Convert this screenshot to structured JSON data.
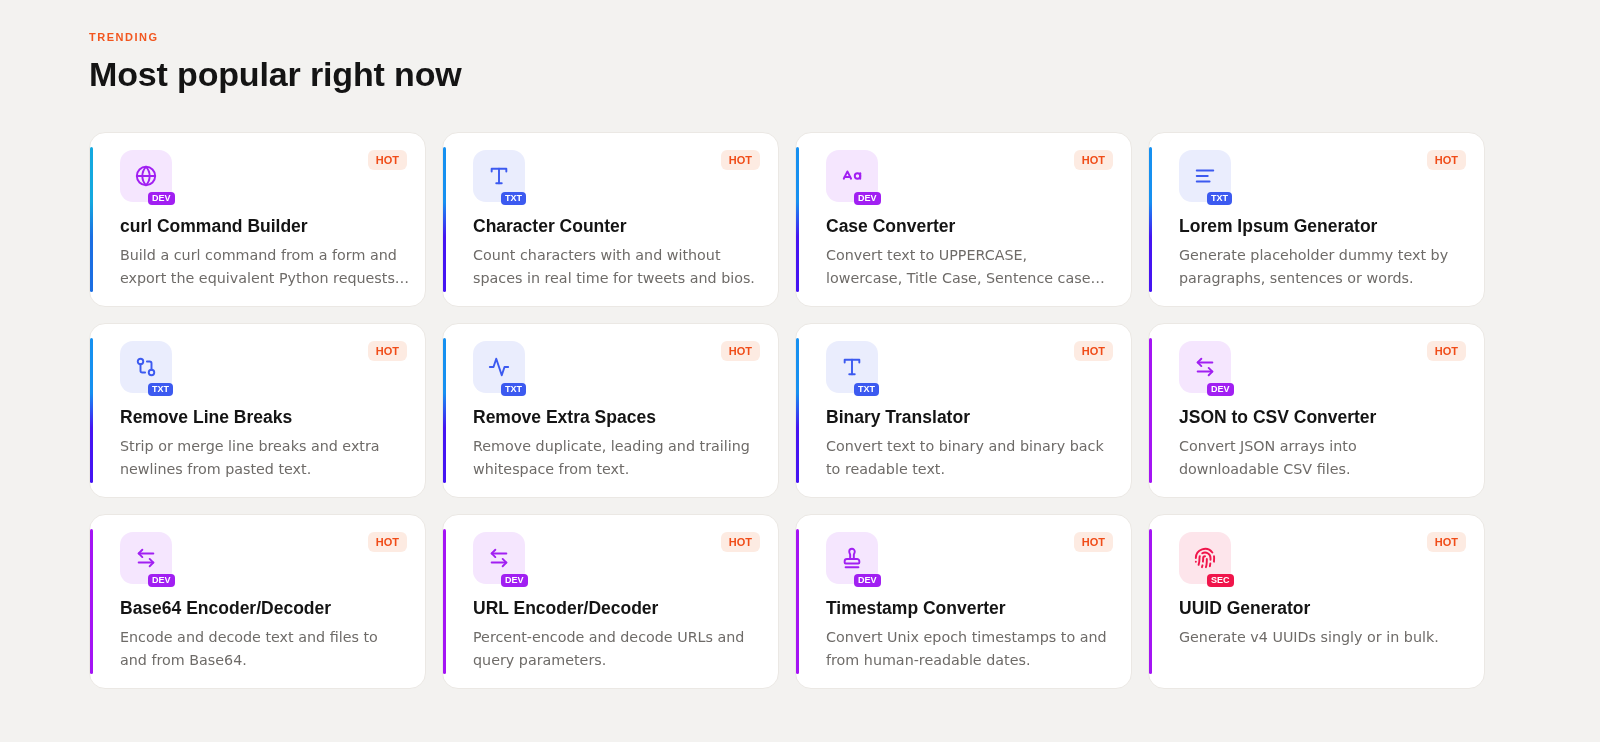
{
  "section": {
    "eyebrow": "TRENDING",
    "title": "Most popular right now"
  },
  "cards": [
    {
      "title": "curl Command Builder",
      "description": [
        "Build a curl command from a form and",
        "export the equivalent Python requests…"
      ],
      "category": {
        "label": "DEV",
        "color": "#a11ff2"
      },
      "badge": "HOT",
      "accent": [
        {
          "color": "#14a8df"
        },
        {
          "color": "#1b6ee2"
        }
      ]
    },
    {
      "title": "Character Counter",
      "description": [
        "Count characters with and without",
        "spaces in real time for tweets and bios."
      ],
      "category": {
        "label": "TXT",
        "color": "#3c5af0"
      },
      "badge": "HOT",
      "accent": [
        {
          "color": "#1690f0"
        },
        {
          "color": "#4514f2"
        }
      ]
    },
    {
      "title": "Case Converter",
      "description": [
        "Convert text to UPPERCASE,",
        "lowercase, Title Case, Sentence case…"
      ],
      "category": {
        "label": "DEV",
        "color": "#a11ff2"
      },
      "badge": "HOT",
      "accent": [
        {
          "color": "#1690f0"
        },
        {
          "color": "#4514f2"
        }
      ]
    },
    {
      "title": "Lorem Ipsum Generator",
      "description": [
        "Generate placeholder dummy text by",
        "paragraphs, sentences or words."
      ],
      "category": {
        "label": "TXT",
        "color": "#3c5af0"
      },
      "badge": "HOT",
      "accent": [
        {
          "color": "#1690f0"
        },
        {
          "color": "#4514f2"
        }
      ]
    },
    {
      "title": "Remove Line Breaks",
      "description": [
        "Strip or merge line breaks and extra",
        "newlines from pasted text."
      ],
      "category": {
        "label": "TXT",
        "color": "#3c5af0"
      },
      "badge": "HOT",
      "accent": [
        {
          "color": "#1690f0"
        },
        {
          "color": "#4514f2"
        }
      ]
    },
    {
      "title": "Remove Extra Spaces",
      "description": [
        "Remove duplicate, leading and trailing",
        "whitespace from text."
      ],
      "category": {
        "label": "TXT",
        "color": "#3c5af0"
      },
      "badge": "HOT",
      "accent": [
        {
          "color": "#1690f0"
        },
        {
          "color": "#4514f2"
        }
      ]
    },
    {
      "title": "Binary Translator",
      "description": [
        "Convert text to binary and binary back",
        "to readable text."
      ],
      "category": {
        "label": "TXT",
        "color": "#3c5af0"
      },
      "badge": "HOT",
      "accent": [
        {
          "color": "#1690f0"
        },
        {
          "color": "#4514f2"
        }
      ]
    },
    {
      "title": "JSON to CSV Converter",
      "description": [
        "Convert JSON arrays into",
        "downloadable CSV files."
      ],
      "category": {
        "label": "DEV",
        "color": "#a11ff2"
      },
      "badge": "HOT",
      "accent": [
        {
          "color": "#a414f4"
        },
        {
          "color": "#a414f4"
        }
      ]
    },
    {
      "title": "Base64 Encoder/Decoder",
      "description": [
        "Encode and decode text and files to",
        "and from Base64."
      ],
      "category": {
        "label": "DEV",
        "color": "#a11ff2"
      },
      "badge": "HOT",
      "accent": [
        {
          "color": "#a414f4"
        },
        {
          "color": "#a414f4"
        }
      ]
    },
    {
      "title": "URL Encoder/Decoder",
      "description": [
        "Percent-encode and decode URLs and",
        "query parameters."
      ],
      "category": {
        "label": "DEV",
        "color": "#a11ff2"
      },
      "badge": "HOT",
      "accent": [
        {
          "color": "#a414f4"
        },
        {
          "color": "#a414f4"
        }
      ]
    },
    {
      "title": "Timestamp Converter",
      "description": [
        "Convert Unix epoch timestamps to and",
        "from human-readable dates."
      ],
      "category": {
        "label": "DEV",
        "color": "#a11ff2"
      },
      "badge": "HOT",
      "accent": [
        {
          "color": "#a414f4"
        },
        {
          "color": "#a414f4"
        }
      ]
    },
    {
      "title": "UUID Generator",
      "description": [
        "Generate v4 UUIDs singly or in bulk."
      ],
      "category": {
        "label": "SEC",
        "color": "#f0154b"
      },
      "badge": "HOT",
      "accent": [
        {
          "color": "#a414f4"
        },
        {
          "color": "#a414f4"
        }
      ]
    }
  ]
}
